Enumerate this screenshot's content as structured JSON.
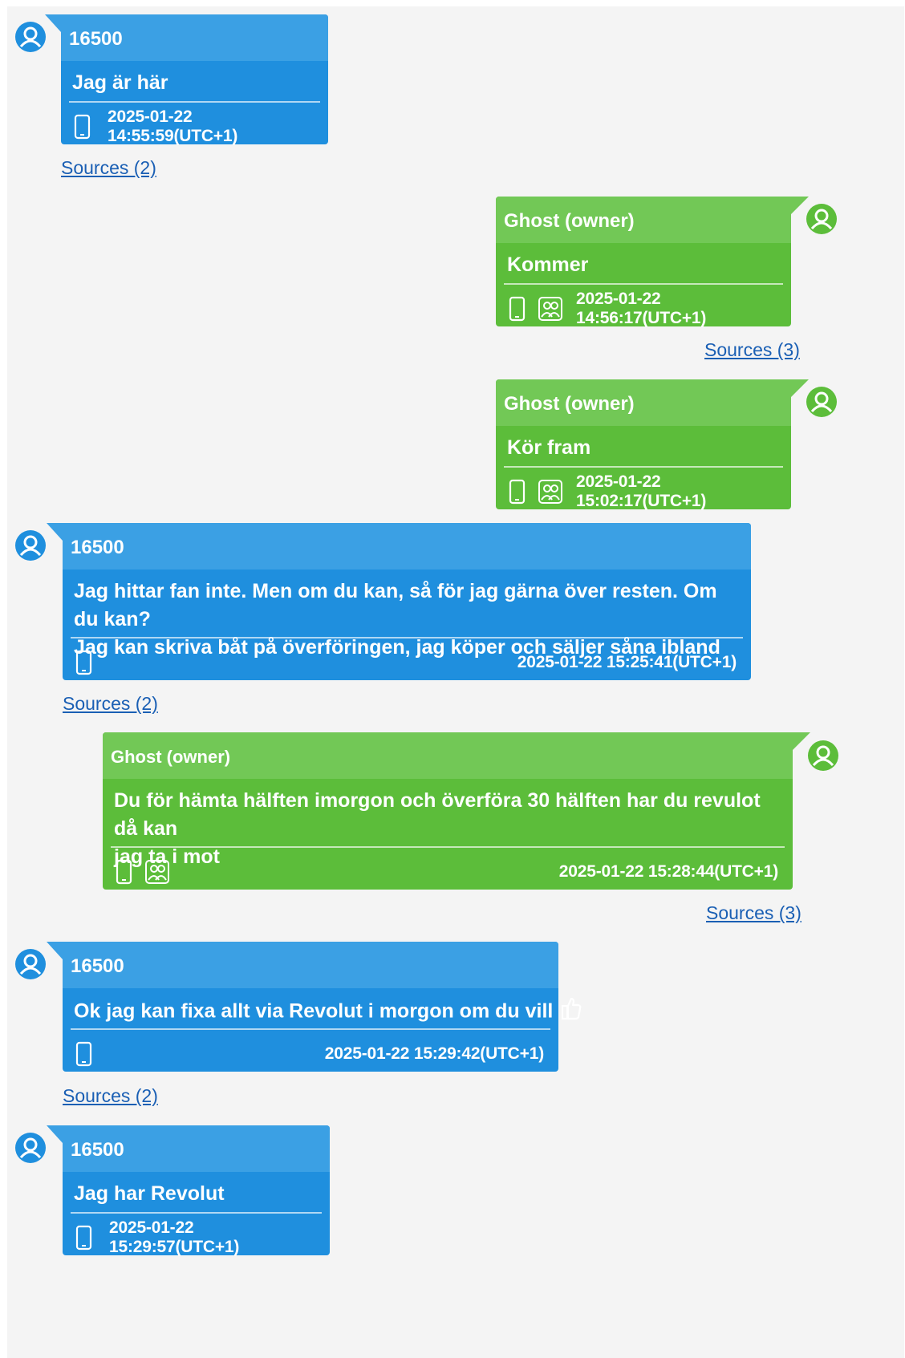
{
  "colors": {
    "incoming": "#1f8fde",
    "outgoing": "#5cbd3a",
    "background": "#f4f4f4",
    "link": "#1a5fb4"
  },
  "icons": {
    "avatar": "user-avatar-icon",
    "device": "phone-icon",
    "group": "group-icon",
    "reaction": "thumbs-up-icon"
  },
  "messages": [
    {
      "sender": "16500",
      "text": "Jag är här",
      "timestamp": "2025-01-22 14:55:59(UTC+1)",
      "sources": "Sources (2)"
    },
    {
      "sender": "Ghost (owner)",
      "text": "Kommer",
      "timestamp": "2025-01-22 14:56:17(UTC+1)",
      "sources": "Sources (3)"
    },
    {
      "sender": "Ghost (owner)",
      "text": "Kör fram",
      "timestamp": "2025-01-22 15:02:17(UTC+1)"
    },
    {
      "sender": "16500",
      "text_lines": [
        "Jag hittar fan inte. Men om du kan, så för jag gärna över resten. Om du kan?",
        "Jag kan skriva båt på överföringen, jag köper och säljer såna ibland"
      ],
      "timestamp": "2025-01-22 15:25:41(UTC+1)",
      "sources": "Sources (2)"
    },
    {
      "sender": "Ghost (owner)",
      "text_lines": [
        "Du för hämta hälften imorgon och överföra 30 hälften har du revulot då kan",
        "jag ta i mot"
      ],
      "timestamp": "2025-01-22 15:28:44(UTC+1)",
      "sources": "Sources (3)"
    },
    {
      "sender": "16500",
      "text": "Ok jag kan fixa allt via Revolut i morgon om du vill",
      "timestamp": "2025-01-22 15:29:42(UTC+1)",
      "sources": "Sources (2)"
    },
    {
      "sender": "16500",
      "text": "Jag har Revolut",
      "timestamp": "2025-01-22 15:29:57(UTC+1)"
    }
  ]
}
